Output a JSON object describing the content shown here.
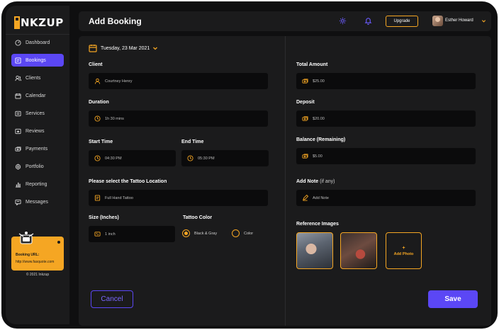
{
  "app": {
    "logo_text": "NKZUP"
  },
  "sidebar": {
    "items": [
      {
        "label": "Dashboard",
        "icon": "dashboard-icon",
        "active": false
      },
      {
        "label": "Bookings",
        "icon": "bookings-icon",
        "active": true
      },
      {
        "label": "Clients",
        "icon": "clients-icon",
        "active": false
      },
      {
        "label": "Calendar",
        "icon": "calendar-icon",
        "active": false
      },
      {
        "label": "Services",
        "icon": "services-icon",
        "active": false
      },
      {
        "label": "Reviews",
        "icon": "reviews-icon",
        "active": false
      },
      {
        "label": "Payments",
        "icon": "payments-icon",
        "active": false
      },
      {
        "label": "Portfolio",
        "icon": "portfolio-icon",
        "active": false
      },
      {
        "label": "Reporting",
        "icon": "reporting-icon",
        "active": false
      },
      {
        "label": "Messages",
        "icon": "messages-icon",
        "active": false
      }
    ],
    "booking_card": {
      "label": "Booking URL:",
      "url": "http://www.fasquote.com"
    },
    "copyright": "© 2021 Inkzup"
  },
  "header": {
    "title": "Add Booking",
    "upgrade_label": "Upgrade",
    "user_name": "Esther Howard"
  },
  "form": {
    "date": "Tuesday, 23 Mar 2021",
    "client": {
      "label": "Client",
      "value": "Courtney Henry"
    },
    "duration": {
      "label": "Duration",
      "value": "1h 30 mins"
    },
    "start_time": {
      "label": "Start Time",
      "value": "04:30 PM"
    },
    "end_time": {
      "label": "End Time",
      "value": "05:30 PM"
    },
    "tattoo_location": {
      "label": "Please select the Tattoo Location",
      "value": "Full Hand Tattoo"
    },
    "size": {
      "label": "Size (Inches)",
      "value": "1 inch"
    },
    "tattoo_color": {
      "label": "Tattoo Color",
      "options": [
        "Black & Gray",
        "Color"
      ],
      "selected": "Black & Gray"
    },
    "total_amount": {
      "label": "Total Amount",
      "value": "$25.00"
    },
    "deposit": {
      "label": "Deposit",
      "value": "$20.00"
    },
    "balance": {
      "label": "Balance (Remaining)",
      "value": "$5.00"
    },
    "note": {
      "label": "Add Note",
      "label_suffix": "(if any)",
      "placeholder": "Add Note"
    },
    "reference_images": {
      "label": "Reference Images",
      "add_label": "Add Photo",
      "add_symbol": "+"
    },
    "cancel_label": "Cancel",
    "save_label": "Save"
  },
  "colors": {
    "accent": "#5b47f5",
    "highlight": "#f5a623",
    "background": "#0f0f10",
    "panel": "#1b1b1c"
  }
}
